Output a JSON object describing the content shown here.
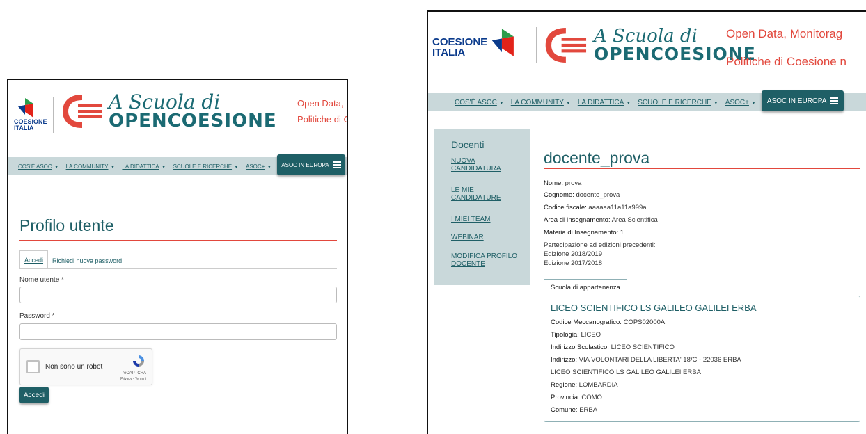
{
  "site": {
    "coesione_line1": "COESIONE",
    "coesione_line2": "ITALIA",
    "brand_script": "A Scuola di",
    "brand_big": "OPENCOESIONE",
    "accent": "#e2483d",
    "primary": "#1f5f66",
    "nav_bg": "#c9d8da"
  },
  "left": {
    "tagline_line1": "Open Data,",
    "tagline_line2": "Politiche di C",
    "nav": [
      "COS'È ASOC",
      "LA COMMUNITY",
      "LA DIDATTICA",
      "SCUOLE E RICERCHE",
      "ASOC+"
    ],
    "nav_europa": "ASOC IN EUROPA",
    "page_title": "Profilo utente",
    "tabs": [
      "Accedi",
      "Richiedi nuova password"
    ],
    "username_label": "Nome utente *",
    "password_label": "Password *",
    "recaptcha_text": "Non sono un robot",
    "recaptcha_name": "reCAPTCHA",
    "recaptcha_privacy": "Privacy - Termini",
    "submit_label": "Accedi"
  },
  "right": {
    "tagline_line1": "Open Data, Monitorag",
    "tagline_line2": "Politiche di Coesione n",
    "nav": [
      "COS'È ASOC",
      "LA COMMUNITY",
      "LA DIDATTICA",
      "SCUOLE E RICERCHE",
      "ASOC+"
    ],
    "nav_europa": "ASOC IN EUROPA",
    "sidebar": {
      "title": "Docenti",
      "items": [
        [
          "NUOVA",
          "CANDIDATURA"
        ],
        [
          "LE MIE",
          "CANDIDATURE"
        ],
        [
          "I MIEI TEAM"
        ],
        [
          "WEBINAR"
        ],
        [
          "MODIFICA PROFILO",
          "DOCENTE"
        ]
      ]
    },
    "profile": {
      "name": "docente_prova",
      "fields": [
        {
          "label": "Nome:",
          "value": "prova"
        },
        {
          "label": "Cognome:",
          "value": "docente_prova"
        },
        {
          "label": "Codice fiscale:",
          "value": "aaaaaa11a11a999a"
        },
        {
          "label": "Area di Insegnamento:",
          "value": "Area Scientifica"
        },
        {
          "label": "Materia di Insegnamento:",
          "value": "1"
        }
      ],
      "editions_label": "Partecipazione ad edizioni precedenti:",
      "editions": [
        "Edizione 2018/2019",
        "Edizione 2017/2018"
      ]
    },
    "school": {
      "tab_label": "Scuola di appartenenza",
      "name": "LICEO SCIENTIFICO LS GALILEO GALILEI ERBA",
      "fields": [
        {
          "label": "Codice Meccanografico:",
          "value": "COPS02000A"
        },
        {
          "label": "Tipologia:",
          "value": "LICEO"
        },
        {
          "label": "Indirizzo Scolastico:",
          "value": "LICEO SCIENTIFICO"
        },
        {
          "label": "Indirizzo:",
          "value": "VIA VOLONTARI DELLA LIBERTA' 18/C - 22036 ERBA"
        },
        {
          "label": "",
          "value": "LICEO SCIENTIFICO LS GALILEO GALILEI ERBA"
        },
        {
          "label": "Regione:",
          "value": "LOMBARDIA"
        },
        {
          "label": "Provincia:",
          "value": "COMO"
        },
        {
          "label": "Comune:",
          "value": "ERBA"
        }
      ]
    }
  }
}
